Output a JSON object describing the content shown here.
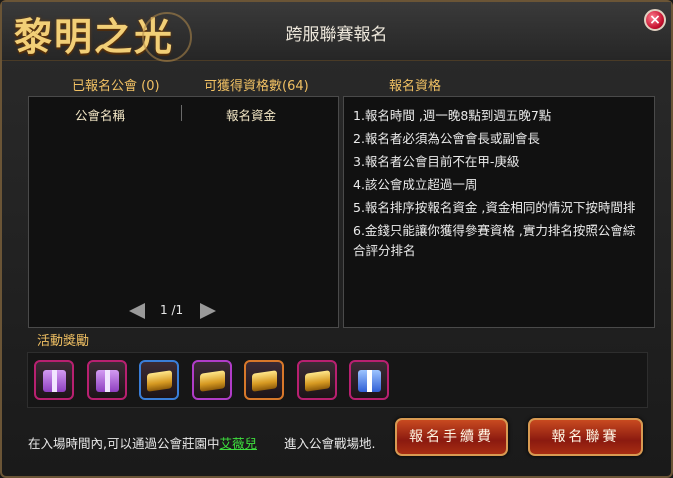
{
  "window": {
    "title": "跨服聯賽報名",
    "logo": "黎明之光"
  },
  "top_labels": {
    "registered": "已報名公會 (0)",
    "qualifiable": "可獲得資格數(64)",
    "qualification": "報名資格"
  },
  "table": {
    "columns": [
      "公會名稱",
      "報名資金"
    ],
    "rows": [],
    "pager": "1 /1"
  },
  "rules": [
    "1.報名時間 ,週一晚8點到週五晚7點",
    "2.報名者必須為公會會長或副會長",
    "3.報名者公會目前不在甲-庚級",
    "4.該公會成立超過一周",
    "5.報名排序按報名資金 ,資金相同的情況下按時間排",
    "6.金錢只能讓你獲得參賽資格 ,實力排名按照公會綜合評分排名"
  ],
  "rewards": {
    "label": "活動獎勵",
    "items": [
      {
        "icon": "purple-gift-icon",
        "frame": "#c0287a"
      },
      {
        "icon": "purple-gift-icon",
        "frame": "#c0287a"
      },
      {
        "icon": "gold-bars-icon",
        "frame": "#3a7ed8"
      },
      {
        "icon": "gold-bars-icon",
        "frame": "#b03cc8"
      },
      {
        "icon": "gold-bars-icon",
        "frame": "#d8782a"
      },
      {
        "icon": "gold-bars-icon",
        "frame": "#c0287a"
      },
      {
        "icon": "blue-gift-icon",
        "frame": "#c0287a"
      }
    ]
  },
  "footer": {
    "prefix": "在入場時間內,可以通過公會莊園中",
    "npc": "艾薇兒",
    "suffix": "進入公會戰場地."
  },
  "buttons": {
    "fee": "報名手續費",
    "register": "報名聯賽"
  }
}
